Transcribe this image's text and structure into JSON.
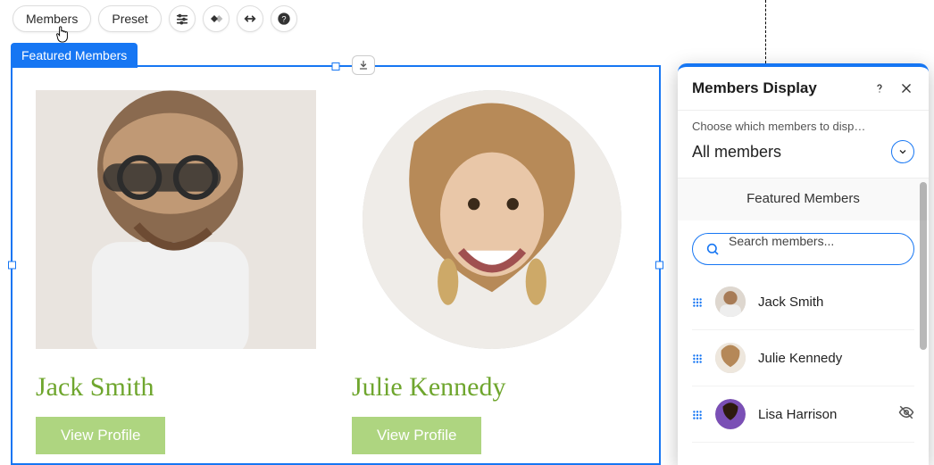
{
  "toolbar": {
    "members_label": "Members",
    "preset_label": "Preset"
  },
  "selection_tag": "Featured Members",
  "cards": [
    {
      "name": "Jack Smith",
      "cta": "View Profile"
    },
    {
      "name": "Julie Kennedy",
      "cta": "View Profile"
    }
  ],
  "panel": {
    "title": "Members Display",
    "choose_label": "Choose which members to disp…",
    "dropdown_value": "All members",
    "featured_heading": "Featured Members",
    "search_placeholder": "Search members...",
    "members": [
      {
        "name": "Jack Smith"
      },
      {
        "name": "Julie Kennedy"
      },
      {
        "name": "Lisa Harrison",
        "hidden": true
      }
    ]
  }
}
